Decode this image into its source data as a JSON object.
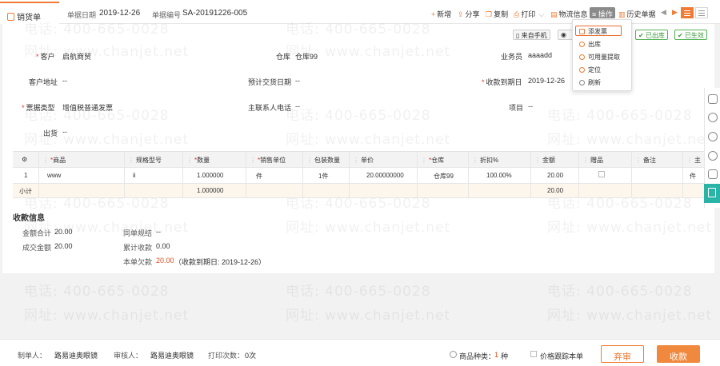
{
  "tab": {
    "label": "销货单"
  },
  "header": {
    "date_label": "单据日期",
    "date_value": "2019-12-26",
    "no_label": "单据编号",
    "no_value": "SA-20191226-005"
  },
  "toolbar": {
    "add": "新增",
    "share": "分享",
    "copy": "复制",
    "print": "打印",
    "logistics": "物流信息",
    "operate": "操作",
    "history": "历史单据"
  },
  "status_chips": {
    "from_mobile": "来自手机",
    "shipped": "已出库",
    "effective": "已生效"
  },
  "dropdown": {
    "items": [
      "添发票",
      "出库",
      "可用量提取",
      "定位",
      "刷新"
    ]
  },
  "form": {
    "customer_label": "客户",
    "customer_value": "启航商贸",
    "warehouse_label": "仓库",
    "warehouse_value": "仓库99",
    "salesman_label": "业务员",
    "salesman_value": "aaaadd",
    "address_label": "客户地址",
    "address_value": "--",
    "delivery_label": "预计交货日期",
    "delivery_value": "--",
    "due_label": "收款到期日",
    "due_value": "2019-12-26",
    "invoice_label": "票据类型",
    "invoice_value": "增值税普通发票",
    "contact_label": "主联系人电话",
    "contact_value": "--",
    "project_label": "项目",
    "project_value": "--",
    "ship_label": "出货",
    "ship_value": "--"
  },
  "grid": {
    "headers": [
      "商品",
      "规格型号",
      "数量",
      "销售单位",
      "包装数量",
      "单价",
      "仓库",
      "折扣%",
      "金额",
      "赠品",
      "备注",
      "主"
    ],
    "row": {
      "no": "1",
      "product": "www",
      "spec": "ii",
      "qty": "1.000000",
      "unit": "件",
      "pack": "1件",
      "price": "20.00000000",
      "warehouse": "仓库99",
      "discount": "100.00%",
      "amount": "20.00",
      "remark": "",
      "main": "件"
    },
    "subtotal": {
      "label": "小计",
      "qty": "1.000000",
      "amount": "20.00"
    }
  },
  "collection": {
    "title": "收款信息",
    "total_label": "金额合计",
    "total_value": "20.00",
    "deal_label": "成交金额",
    "deal_value": "20.00",
    "rule_label": "同单规结",
    "rule_value": "--",
    "accum_label": "累计收款",
    "accum_value": "0.00",
    "owed_label": "本单欠款",
    "owed_value": "20.00",
    "owed_note": "（收款到期日: 2019-12-26）"
  },
  "footer": {
    "maker_label": "制单人：",
    "maker_value": "路易迪奥眼镜",
    "auditor_label": "审核人：",
    "auditor_value": "路易迪奥眼镜",
    "print_label": "打印次数：",
    "print_value": "0次",
    "kinds_label": "商品种类：",
    "kinds_value": "1",
    "kinds_unit": "种",
    "track_label": "价格跟踪本单",
    "audit_btn": "弃审",
    "collect_btn": "收款"
  },
  "watermark": {
    "phone": "电话: 400-665-0028",
    "site": "网址: www.chanjet.net"
  },
  "colors": {
    "accent": "#f07b34",
    "green": "#52b152",
    "teal": "#2ab4a8",
    "required": "#e03030"
  }
}
